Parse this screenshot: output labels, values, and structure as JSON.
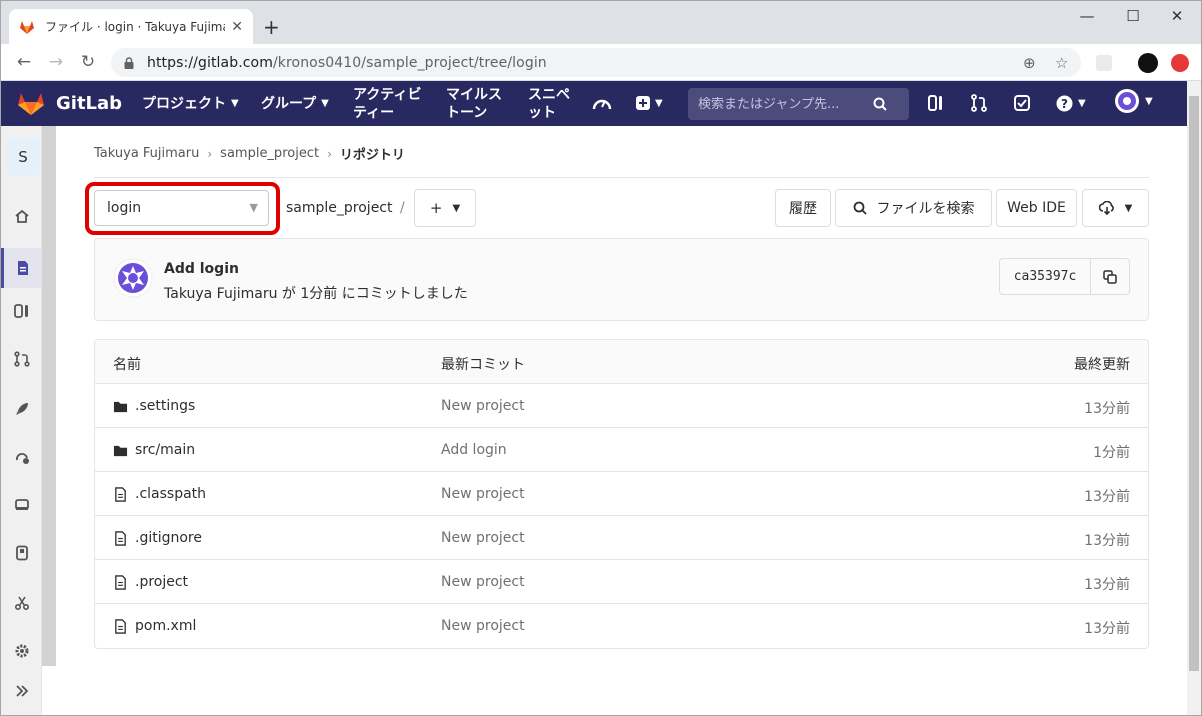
{
  "browser": {
    "tab_title": "ファイル · login · Takuya Fujimaru /",
    "url_host": "https://gitlab.com",
    "url_path": "/kronos0410/sample_project/tree/login"
  },
  "gitlab": {
    "brand": "GitLab",
    "menu": {
      "projects": "プロジェクト",
      "groups": "グループ",
      "activity_1": "アクティビ",
      "activity_2": "ティー",
      "milestones_1": "マイルス",
      "milestones_2": "トーン",
      "snippets_1": "スニペ",
      "snippets_2": "ット"
    },
    "search_placeholder": "検索またはジャンプ先..."
  },
  "sidebar": {
    "project_initial": "S"
  },
  "breadcrumb": [
    "Takuya Fujimaru",
    "sample_project",
    "リポジトリ"
  ],
  "toolbar": {
    "branch": "login",
    "path_root": "sample_project",
    "path_sep": "/",
    "add": "+",
    "history": "履歴",
    "find_file": "ファイルを検索",
    "web_ide": "Web IDE"
  },
  "commit": {
    "title": "Add login",
    "meta": "Takuya Fujimaru が 1分前 にコミットしました",
    "sha": "ca35397c"
  },
  "files": {
    "headers": {
      "name": "名前",
      "last_commit": "最新コミット",
      "updated": "最終更新"
    },
    "rows": [
      {
        "type": "folder",
        "name": ".settings",
        "commit": "New project",
        "updated": "13分前"
      },
      {
        "type": "folder",
        "name": "src/main",
        "commit": "Add login",
        "updated": "1分前"
      },
      {
        "type": "file",
        "name": ".classpath",
        "commit": "New project",
        "updated": "13分前"
      },
      {
        "type": "file",
        "name": ".gitignore",
        "commit": "New project",
        "updated": "13分前"
      },
      {
        "type": "file",
        "name": ".project",
        "commit": "New project",
        "updated": "13分前"
      },
      {
        "type": "file",
        "name": "pom.xml",
        "commit": "New project",
        "updated": "13分前"
      }
    ]
  },
  "colors": {
    "navbar": "#292961",
    "highlight": "#e00000"
  }
}
